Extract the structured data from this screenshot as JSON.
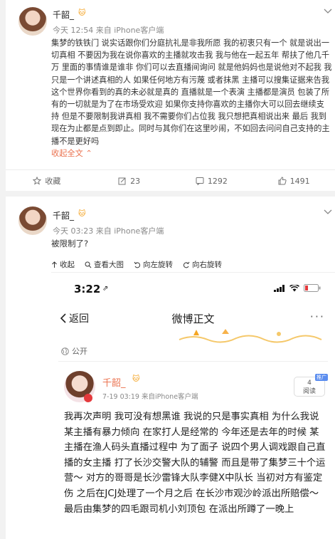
{
  "post1": {
    "username": "千韶_",
    "vip_badge": "🐱",
    "meta": "今天 12:54 来自 iPhone客户端",
    "body": "集梦的铁铁门 说实话跟你们分庭抗礼是非我所愿 我的初衷只有一个 就是说出一切真相 不要因为我在说你喜欢的主播就攻击我 我与他在一起五年 帮扶了他几千万 里面的事情谁是谁非 你们可以去直播间询问 就是他妈妈也是说他对不起我 我只是一个讲述真相的人 如果任何地方有污蔑 或者抹黑 主播可以搜集证据来告我 这个世界你看到的真的未必就是真的 直播就是一个表演 主播都是演员 包装了所有的一切就是为了在市场受欢迎 如果你支持你喜欢的主播你大可以回去继续支持 但是不要限制我讲真相 我不需要你们占位我 我只想把真相说出来 最后 我到现在为止都是点到即止。同时与其你们在这里吵闹，不如回去问问自己支持的主播不是更好吗",
    "expand_label": "收起全文",
    "expand_arrow": "⌃",
    "actions": [
      {
        "icon": "star-icon",
        "label": "收藏"
      },
      {
        "icon": "repost-icon",
        "label": "23"
      },
      {
        "icon": "comment-icon",
        "label": "1292"
      },
      {
        "icon": "like-icon",
        "label": "1491"
      }
    ]
  },
  "post2": {
    "username": "千韶_",
    "vip_badge": "🐱",
    "meta": "今天 03:23 来自 iPhone客户端",
    "body": "被限制了?",
    "toolbar": [
      {
        "icon": "collapse-arrow-icon",
        "label": "收起"
      },
      {
        "icon": "zoom-icon",
        "label": "查看大图"
      },
      {
        "icon": "rotate-left-icon",
        "label": "向左旋转"
      },
      {
        "icon": "rotate-right-icon",
        "label": "向右旋转"
      }
    ],
    "screenshot": {
      "time": "3:22",
      "location_arrow": "⇗",
      "back_label": "返回",
      "title": "微博正文",
      "more": "···",
      "visibility": "公开",
      "author": "千韶_",
      "author_vip": "🐱",
      "author_meta": "7-19 03:19  来自iPhone客户端",
      "read_count": "4",
      "read_label": "阅读",
      "read_tag": "推广",
      "text": "我再次声明 我可没有想黑谁 我说的只是事实真相 为什么我说某主播有暴力倾向 在家打人是经常的 今年还是去年的时候 某主播在渔人码头直播过程中 为了面子 说四个男人调戏跟自己直播的女主播 打了长沙交警大队的辅警 而且是带了集梦三十个运营～ 对方的哥哥是长沙雷锋大队李健X中队长 当初对方有鉴定伤 之后在JCJ处理了一个月之后 在长沙市观沙岭派出所赔偿～最后由集梦的四毛跟司机小刘顶包 在派出所蹲了一晚上"
    }
  },
  "colors": {
    "accent": "#eb7350",
    "link": "#eb7350",
    "vip": "#f39c12"
  }
}
